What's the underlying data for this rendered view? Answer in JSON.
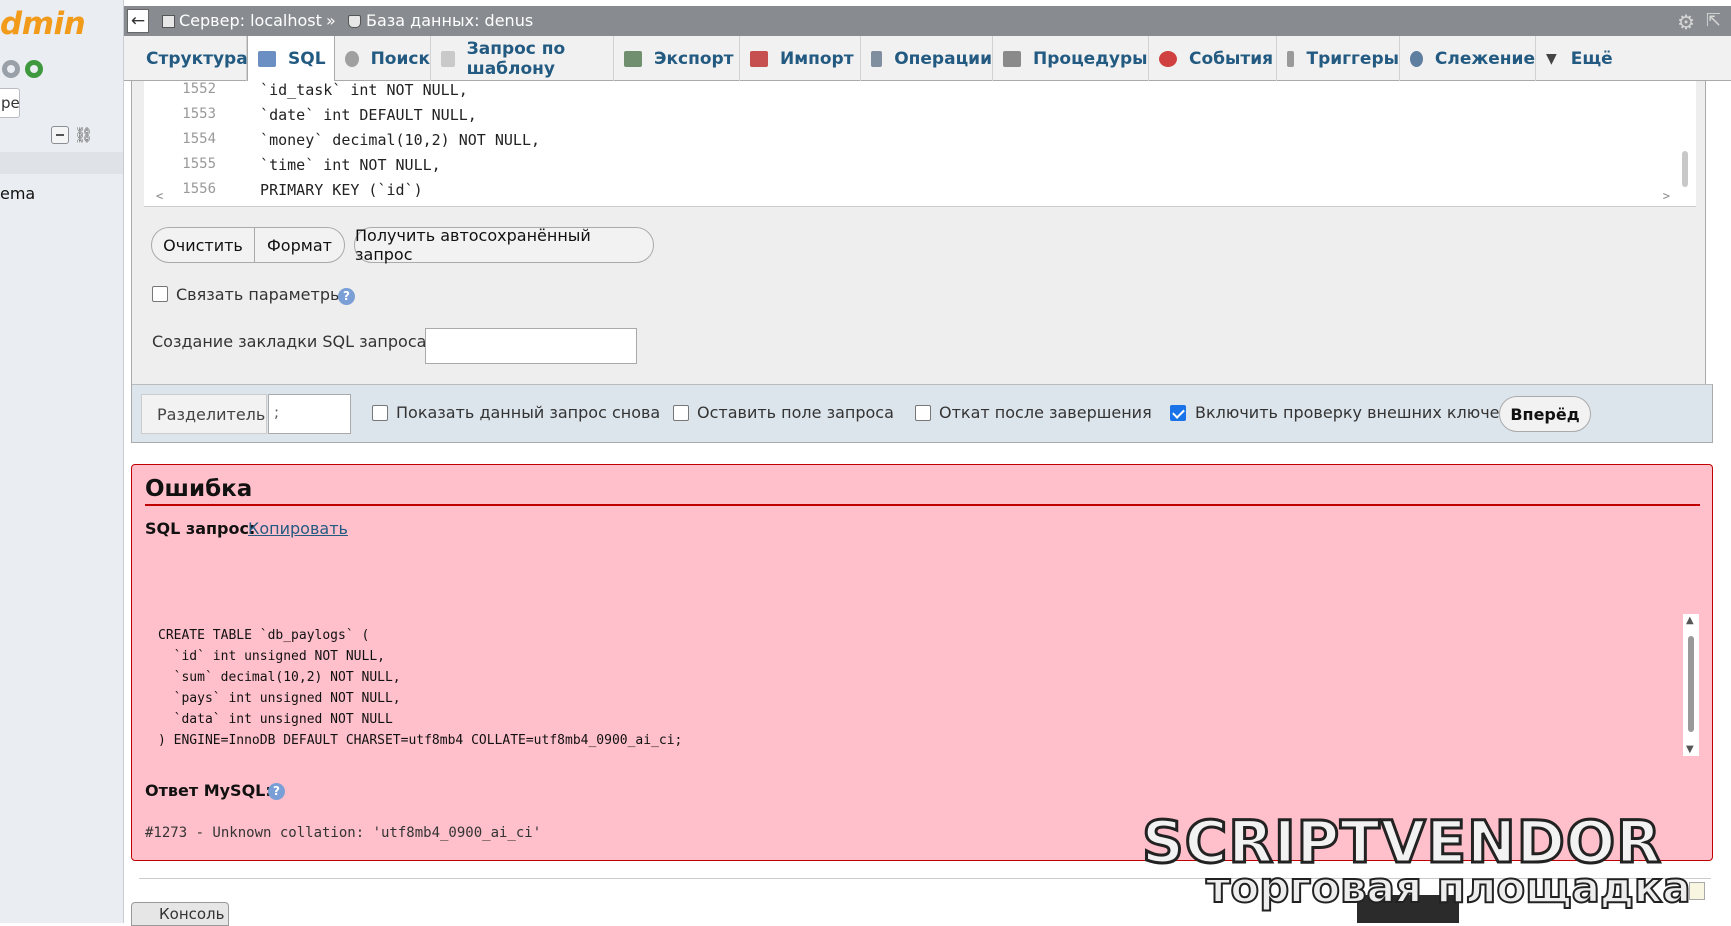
{
  "sidebar": {
    "logo_text": "dmin",
    "input_value": "pe",
    "item_label": "ema",
    "logo_color": "#f29a1a"
  },
  "topbar": {
    "back_glyph": "←",
    "server_crumb": "Сервер: localhost",
    "separator": "»",
    "database_crumb": "База данных: denus",
    "gear_glyph": "⚙",
    "collapse_glyph": "⇱"
  },
  "tabs": [
    {
      "label": "Структура",
      "icon": "structure-icon",
      "color": "#4a77b4"
    },
    {
      "label": "SQL",
      "icon": "sql-icon",
      "color": "#6b8fc2"
    },
    {
      "label": "Поиск",
      "icon": "search-icon",
      "color": "#a0a0a0"
    },
    {
      "label": "Запрос по шаблону",
      "icon": "query-template-icon",
      "color": "#c9c9c9"
    },
    {
      "label": "Экспорт",
      "icon": "export-icon",
      "color": "#6f8f6f"
    },
    {
      "label": "Импорт",
      "icon": "import-icon",
      "color": "#c65050"
    },
    {
      "label": "Операции",
      "icon": "wrench-icon",
      "color": "#7f8fa0"
    },
    {
      "label": "Процедуры",
      "icon": "routines-icon",
      "color": "#8a8a8a"
    },
    {
      "label": "События",
      "icon": "events-clock-icon",
      "color": "#d04040"
    },
    {
      "label": "Триггеры",
      "icon": "triggers-icon",
      "color": "#9a9a9a"
    },
    {
      "label": "Слежение",
      "icon": "eye-icon",
      "color": "#5f7fa0"
    },
    {
      "label": "Ещё",
      "icon": "chevron-down-icon",
      "color": "#444444"
    }
  ],
  "editor": {
    "lines": [
      {
        "no": "1552",
        "code": "  `id_task` int NOT NULL,"
      },
      {
        "no": "1553",
        "code": "  `date` int DEFAULT NULL,"
      },
      {
        "no": "1554",
        "code": "  `money` decimal(10,2) NOT NULL,"
      },
      {
        "no": "1555",
        "code": "  `time` int NOT NULL,"
      },
      {
        "no": "1556",
        "code": "  PRIMARY KEY (`id`)"
      }
    ],
    "scroll_left": "<",
    "scroll_right": ">"
  },
  "buttons": {
    "clear": "Очистить",
    "format": "Формат",
    "autosaved": "Получить автосохранённый запрос",
    "go": "Вперёд"
  },
  "bind_params": {
    "label": "Связать параметры",
    "checked": false
  },
  "bookmark": {
    "label": "Создание закладки SQL запроса:",
    "value": ""
  },
  "options": {
    "delimiter_label": "Разделитель",
    "delimiter_value": ";",
    "show_query_again": {
      "label": "Показать данный запрос снова",
      "checked": false
    },
    "retain_query_box": {
      "label": "Оставить поле запроса",
      "checked": false
    },
    "rollback_when_finished": {
      "label": "Откат после завершения",
      "checked": false
    },
    "foreign_key_checks": {
      "label": "Включить проверку внешних ключей",
      "checked": true
    }
  },
  "error": {
    "title": "Ошибка",
    "sql_label": "SQL запрос:",
    "copy_link": "Копировать",
    "sql_lines": [
      "CREATE TABLE `db_paylogs` (",
      "  `id` int unsigned NOT NULL,",
      "  `sum` decimal(10,2) NOT NULL,",
      "  `pays` int unsigned NOT NULL,",
      "  `data` int unsigned NOT NULL",
      ") ENGINE=InnoDB DEFAULT CHARSET=utf8mb4 COLLATE=utf8mb4_0900_ai_ci;"
    ],
    "mysql_label": "Ответ MySQL:",
    "mysql_message": "#1273 - Unknown collation: 'utf8mb4_0900_ai_ci'",
    "background_color": "#ffc0cb",
    "border_color": "#c00000"
  },
  "console": {
    "label": "Консоль"
  },
  "watermark": {
    "main": "SCRIPTVENDOR",
    "sub": "торговая площадка"
  },
  "help_glyph": "?"
}
